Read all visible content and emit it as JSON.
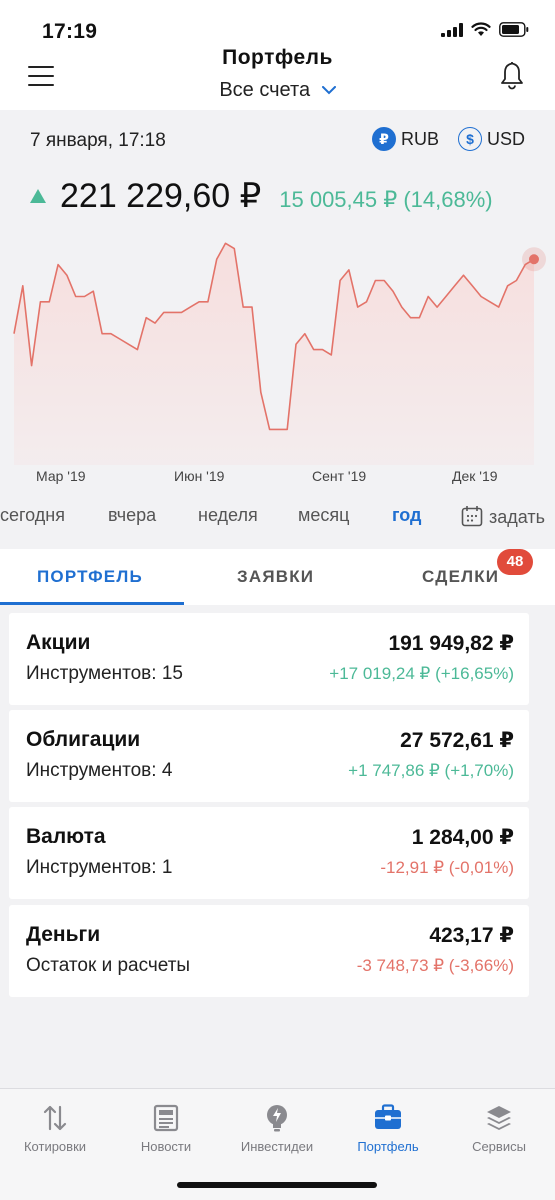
{
  "status_bar": {
    "time": "17:19"
  },
  "header": {
    "title": "Портфель",
    "account": "Все счета"
  },
  "summary": {
    "date": "7 января, 17:18",
    "currency_rub": "RUB",
    "currency_usd": "USD",
    "currency_rub_symbol": "₽",
    "currency_usd_symbol": "$",
    "total": "221 229,60 ₽",
    "change": "15 005,45 ₽ (14,68%)"
  },
  "chart_data": {
    "type": "area",
    "x_labels": [
      "Мар '19",
      "Июн '19",
      "Сент '19",
      "Дек '19"
    ],
    "values": [
      207,
      216,
      201,
      213,
      213,
      220,
      218,
      214,
      214,
      215,
      207,
      207,
      206,
      205,
      204,
      210,
      209,
      211,
      211,
      211,
      212,
      213,
      213,
      221,
      224,
      223,
      212,
      212,
      196,
      189,
      189,
      189,
      205,
      207,
      204,
      204,
      203,
      217,
      219,
      212,
      213,
      217,
      217,
      215,
      212,
      210,
      210,
      214,
      212,
      214,
      216,
      218,
      216,
      214,
      213,
      212,
      216,
      217,
      220,
      221
    ],
    "line_color": "#e37369",
    "fill_color": "#f7dcdb"
  },
  "periods": [
    "сегодня",
    "вчера",
    "неделя",
    "месяц",
    "год",
    "задать"
  ],
  "active_period": "год",
  "tabs": {
    "portfolio": "ПОРТФЕЛЬ",
    "orders": "ЗАЯВКИ",
    "deals": "СДЕЛКИ",
    "deals_badge": "48"
  },
  "cards": [
    {
      "title": "Акции",
      "value": "191 949,82 ₽",
      "sub": "Инструментов: 15",
      "change": "+17 019,24 ₽ (+16,65%)"
    },
    {
      "title": "Облигации",
      "value": "27 572,61 ₽",
      "sub": "Инструментов: 4",
      "change": "+1 747,86 ₽ (+1,70%)"
    },
    {
      "title": "Валюта",
      "value": "1 284,00 ₽",
      "sub": "Инструментов: 1",
      "change": "-12,91 ₽ (-0,01%)"
    },
    {
      "title": "Деньги",
      "value": "423,17 ₽",
      "sub": "Остаток и расчеты",
      "change": "-3 748,73 ₽ (-3,66%)"
    }
  ],
  "tabbar": {
    "quotes": "Котировки",
    "news": "Новости",
    "ideas": "Инвестидеи",
    "portfolio": "Портфель",
    "services": "Сервисы"
  },
  "colors": {
    "accent": "#1f6fd1",
    "positive": "#4cb997",
    "negative": "#e37369",
    "badge": "#e14b3b"
  }
}
